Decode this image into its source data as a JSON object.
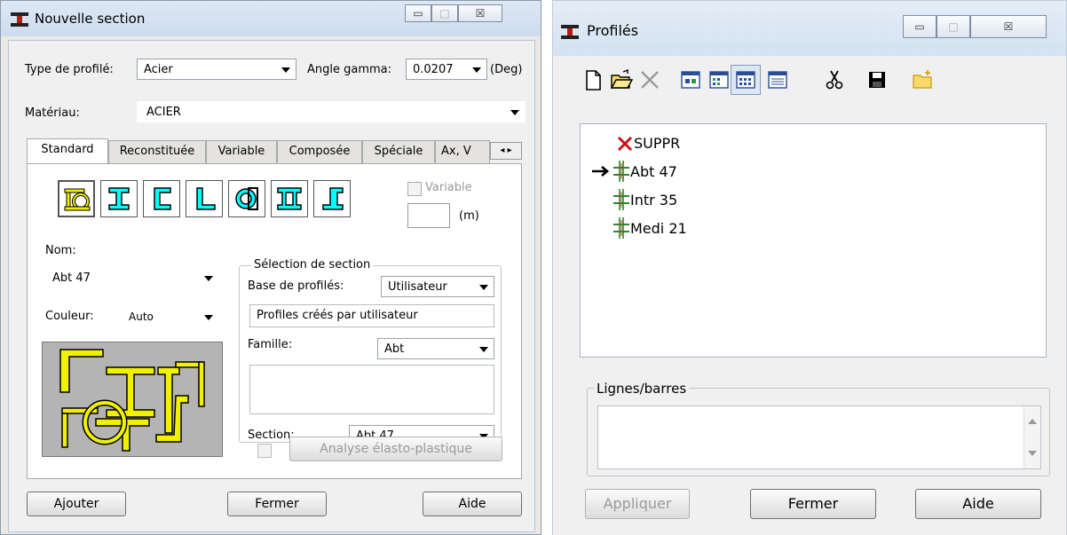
{
  "colors": {
    "title_gradient_top": "#dbe7f5",
    "title_gradient_bottom": "#c6d8ee",
    "window_bg": "#eae9e5",
    "preview_bg": "#b4b4b4",
    "profile_yellow": "#f0f000",
    "tree_green": "#2a8a2a",
    "delete_red": "#cc1111"
  },
  "left_window": {
    "title": "Nouvelle section",
    "title_icon": "steel-i-beam-icon",
    "controls": {
      "minimize": "▭",
      "maximize": "□",
      "close": "☒"
    },
    "type_profile_label": "Type de profilé:",
    "type_profile_value": "Acier",
    "angle_label": "Angle gamma:",
    "angle_value": "0.0207",
    "angle_unit": "(Deg)",
    "material_label": "Matériau:",
    "material_value": "ACIER",
    "tabs": [
      "Standard",
      "Reconstituée",
      "Variable",
      "Composée",
      "Spéciale",
      "Ax, V"
    ],
    "profile_type_icons": [
      "double-profile-icon",
      "i-beam-icon",
      "channel-icon",
      "angle-icon",
      "tube-icon",
      "double-i-icon",
      "tee-icon"
    ],
    "variable_checkbox_label": "Variable",
    "variable_unit": "(m)",
    "nom_label": "Nom:",
    "nom_value": "Abt 47",
    "couleur_label": "Couleur:",
    "couleur_value": "Auto",
    "selection_group_label": "Sélection de section",
    "base_label": "Base de profilés:",
    "base_value": "Utilisateur",
    "base_description": "Profiles créés par utilisateur",
    "famille_label": "Famille:",
    "famille_value": "Abt",
    "section_label": "Section:",
    "section_value": "Abt 47",
    "analyse_button": "Analyse élasto-plastique",
    "buttons": {
      "ajouter": "Ajouter",
      "fermer": "Fermer",
      "aide": "Aide"
    }
  },
  "right_window": {
    "title": "Profilés",
    "title_icon": "steel-i-beam-icon",
    "controls": {
      "minimize": "▭",
      "maximize": "□",
      "close": "☒"
    },
    "toolbar_icons": [
      "new-document-icon",
      "open-folder-icon",
      "delete-x-icon",
      "view-large-icons-icon",
      "view-small-icons-icon",
      "view-list-icon",
      "view-details-icon",
      "cut-icon",
      "save-icon",
      "new-folder-icon"
    ],
    "tree_items": [
      {
        "label": "SUPPR",
        "icon": "delete-x-icon"
      },
      {
        "label": "Abt 47",
        "icon": "profile-section-icon",
        "selected_arrow": true
      },
      {
        "label": "Intr 35",
        "icon": "profile-section-icon"
      },
      {
        "label": "Medi 21",
        "icon": "profile-section-icon"
      }
    ],
    "lines_group_label": "Lignes/barres",
    "buttons": {
      "appliquer": "Appliquer",
      "fermer": "Fermer",
      "aide": "Aide"
    }
  }
}
